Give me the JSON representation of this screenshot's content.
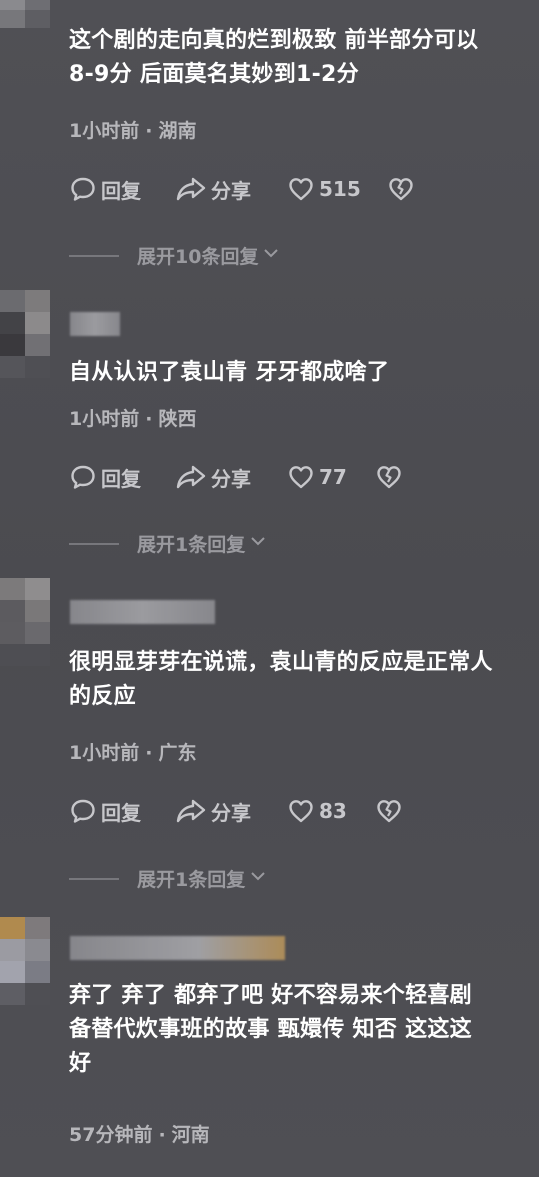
{
  "comments": [
    {
      "text_lines": [
        "这个剧的走向真的烂到极致 前半部分可以",
        "8-9分 后面莫名其妙到1-2分"
      ],
      "time": "1小时前",
      "location": "湖南",
      "reply_label": "回复",
      "share_label": "分享",
      "likes": "515",
      "expand_label": "展开10条回复"
    },
    {
      "text_lines": [
        "自从认识了袁山青 牙牙都成啥了"
      ],
      "time": "1小时前",
      "location": "陕西",
      "reply_label": "回复",
      "share_label": "分享",
      "likes": "77",
      "expand_label": "展开1条回复"
    },
    {
      "text_lines": [
        "很明显芽芽在说谎，袁山青的反应是正常人",
        "的反应"
      ],
      "time": "1小时前",
      "location": "广东",
      "reply_label": "回复",
      "share_label": "分享",
      "likes": "83",
      "expand_label": "展开1条回复"
    },
    {
      "text_lines": [
        "弃了 弃了 都弃了吧 好不容易来个轻喜剧",
        "备替代炊事班的故事 甄嬛传 知否 这这这",
        "好"
      ],
      "time": "57分钟前",
      "location": "河南"
    }
  ],
  "separator": "·",
  "colors": {
    "background": "#4e4e53",
    "text": "#ffffff",
    "meta": "#b7b7bb",
    "action": "#c7c7cb",
    "expand": "#9a9a9f"
  },
  "icons": {
    "reply": "speech-bubble-icon",
    "share": "share-arrow-icon",
    "like": "heart-icon",
    "dislike": "broken-heart-icon",
    "expand": "chevron-down-icon"
  }
}
